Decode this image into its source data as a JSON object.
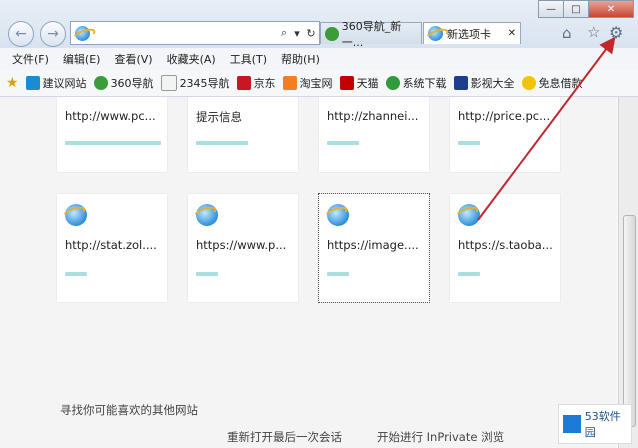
{
  "window_controls": {
    "minimize": "—",
    "maximize": "□",
    "close": "✕"
  },
  "address_bar": {
    "value": "",
    "search_symbol": "⌕",
    "dropdown_symbol": "▾",
    "refresh_symbol": "↻"
  },
  "tabs": [
    {
      "label": "360导航_新一..."
    },
    {
      "label": "新选项卡",
      "close": "✕"
    }
  ],
  "menu": [
    "文件(F)",
    "编辑(E)",
    "查看(V)",
    "收藏夹(A)",
    "工具(T)",
    "帮助(H)"
  ],
  "favorites": [
    "建议网站",
    "360导航",
    "2345导航",
    "京东",
    "淘宝网",
    "天猫",
    "系统下载",
    "影视大全",
    "免息借款"
  ],
  "tiles_row1": [
    "http://www.pc...",
    "提示信息",
    "http://zhannei...",
    "http://price.pc..."
  ],
  "tiles_row2": [
    "http://stat.zol....",
    "https://www.p...",
    "https://image....",
    "https://s.taoba..."
  ],
  "footer": {
    "suggest": "寻找你可能喜欢的其他网站",
    "reopen": "重新打开最后一次会话",
    "inprivate": "开始进行 InPrivate 浏览",
    "watermark": "53软件园"
  },
  "colors": {
    "arrow": "#c0282e",
    "tile_bar": "#a9dfe0",
    "ie_blue": "#2f8ed8"
  }
}
